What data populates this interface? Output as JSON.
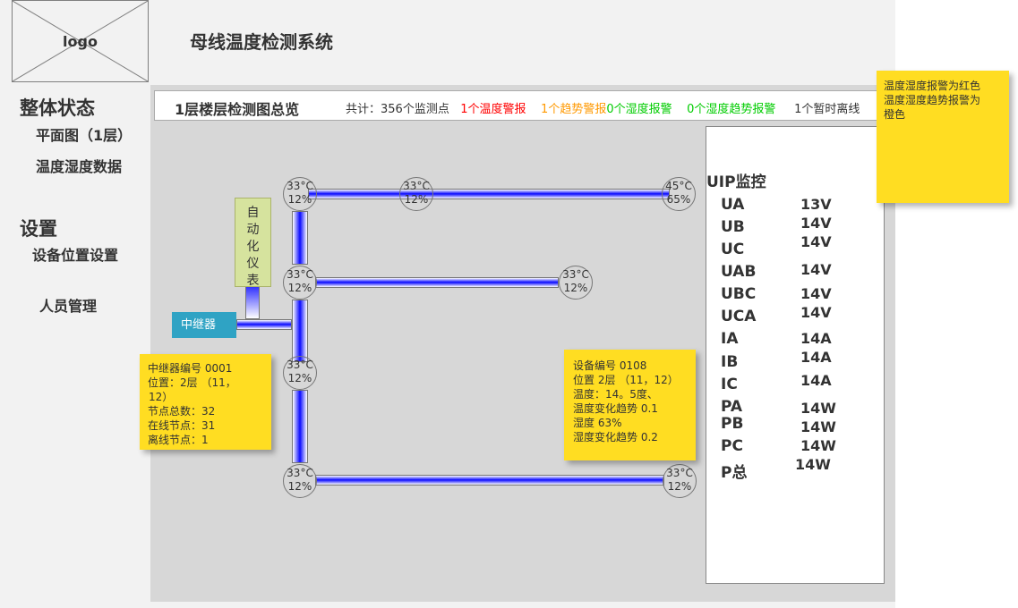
{
  "header": {
    "logo": "logo",
    "title": "母线温度检测系统"
  },
  "sidebar": {
    "section1": "整体状态",
    "item_floor_plan": "平面图（1层）",
    "item_temp_data": "温度湿度数据",
    "section2": "设置",
    "item_device_pos": "设备位置设置",
    "item_personnel": "人员管理"
  },
  "summary": {
    "title": "1层楼层检测图总览",
    "total": "共计：356个监测点",
    "temp_alarm": "1个温度警报",
    "trend_alarm": "1个趋势警报",
    "humidity_alarm": "0个湿度报警",
    "humidity_trend_alarm": "0个湿度趋势报警",
    "offline": "1个暂时离线"
  },
  "nodes": [
    {
      "temp": "33°C",
      "hum": "12%",
      "status": "green"
    },
    {
      "temp": "33°C",
      "hum": "12%",
      "status": "green"
    },
    {
      "temp": "45°C",
      "hum": "65%",
      "status": "red"
    },
    {
      "temp": "33°C",
      "hum": "12%",
      "status": "green"
    },
    {
      "temp": "33°C",
      "hum": "12%",
      "status": "yellow"
    },
    {
      "temp": "33°C",
      "hum": "12%",
      "status": "green"
    },
    {
      "temp": "33°C",
      "hum": "12%",
      "status": "green"
    },
    {
      "temp": "33°C",
      "hum": "12%",
      "status": "green"
    }
  ],
  "auto_meter": "自动化仪表",
  "repeater": "中继器",
  "repeater_info": {
    "line1": "中继器编号 0001",
    "line2": "位置：2层 （11，",
    "line3": "12）",
    "line4": "节点总数：32",
    "line5": "在线节点：31",
    "line6": "离线节点：1"
  },
  "device_info": {
    "line1": "设备编号 0108",
    "line2": "位置 2层 （11，12）",
    "line3": "温度：14。5度、",
    "line4": "温度变化趋势 0.1",
    "line5": "湿度 63%",
    "line6": "湿度变化趋势 0.2"
  },
  "legend_note": {
    "line1": "温度湿度报警为红色",
    "line2": "温度湿度趋势报警为",
    "line3": "橙色"
  },
  "uip": {
    "title": "UIP监控",
    "rows": [
      {
        "label": "UA",
        "value": "13V"
      },
      {
        "label": "UB",
        "value": "14V"
      },
      {
        "label": "UC",
        "value": "14V"
      },
      {
        "label": "UAB",
        "value": "14V"
      },
      {
        "label": "UBC",
        "value": "14V"
      },
      {
        "label": "UCA",
        "value": "14V"
      },
      {
        "label": "IA",
        "value": "14A"
      },
      {
        "label": "IB",
        "value": "14A"
      },
      {
        "label": "IC",
        "value": "14A"
      },
      {
        "label": "PA",
        "value": "14W"
      },
      {
        "label": "PB",
        "value": "14W"
      },
      {
        "label": "PC",
        "value": "14W"
      },
      {
        "label": "P总",
        "value": "14W"
      }
    ]
  },
  "colors": {
    "temp_alarm": "#ff0000",
    "trend_alarm": "#ff9900",
    "humidity_alarm": "#00cc00",
    "humidity_trend_alarm": "#00cc00",
    "note_bg": "#ffdd22",
    "repeater_bg": "#2fa3c4"
  }
}
